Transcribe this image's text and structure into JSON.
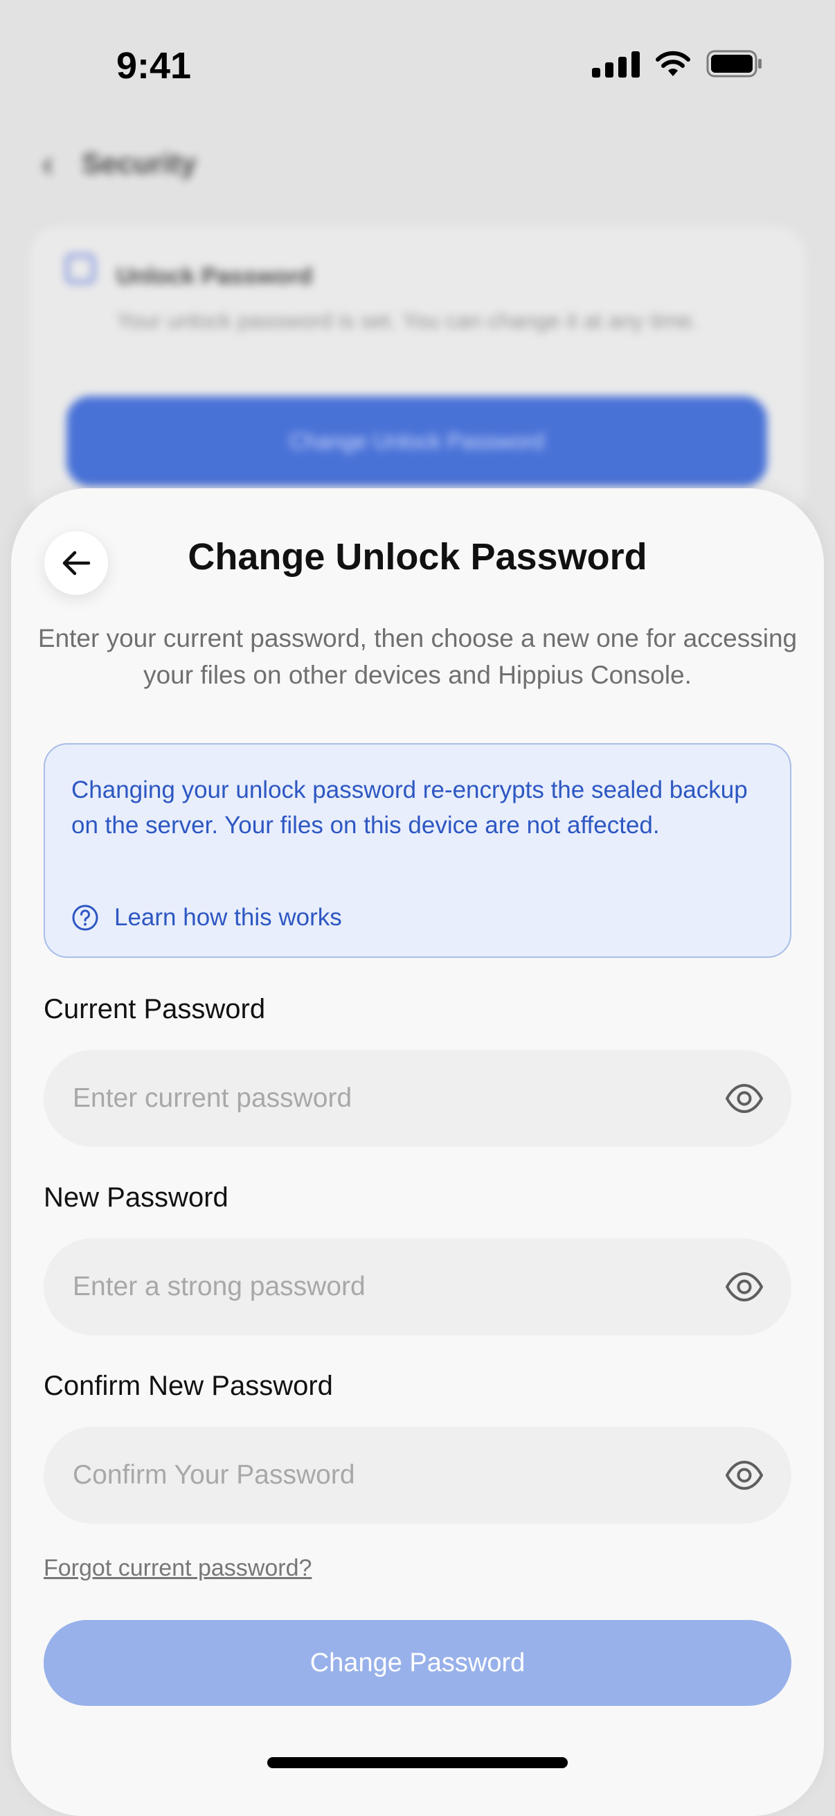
{
  "status_bar": {
    "time": "9:41"
  },
  "background": {
    "nav_title": "Security",
    "card_title": "Unlock Password",
    "card_text": "Your unlock password is set. You can change it at any time.",
    "card_button": "Change Unlock Password"
  },
  "sheet": {
    "title": "Change Unlock Password",
    "description": "Enter your current password, then choose a new one for accessing your files on other devices and Hippius Console.",
    "info": {
      "text": "Changing your unlock password re-encrypts the sealed backup on the server. Your files on this device are not affected.",
      "link": "Learn how this works"
    },
    "fields": {
      "current": {
        "label": "Current Password",
        "placeholder": "Enter current password"
      },
      "new": {
        "label": "New Password",
        "placeholder": "Enter a strong password"
      },
      "confirm": {
        "label": "Confirm New Password",
        "placeholder": "Confirm Your Password"
      }
    },
    "forgot_link": "Forgot current password?",
    "submit_label": "Change Password"
  },
  "icons": {
    "back": "arrow-left-icon",
    "help": "question-circle-icon",
    "eye": "eye-icon"
  },
  "colors": {
    "primary": "#2f5fd6",
    "info_text": "#2d57c2",
    "info_bg": "#e8eefc",
    "button_disabled": "#98b1ea"
  }
}
